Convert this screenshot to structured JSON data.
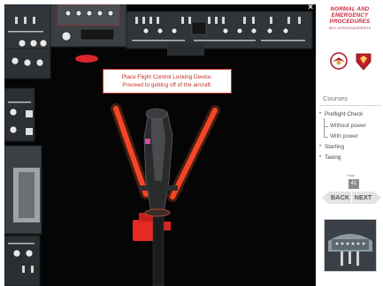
{
  "window": {
    "close_glyph": "×"
  },
  "simulation": {
    "instruction_line1": "Place Flight Control Locking Device.",
    "instruction_line2": "Proceed to getting off of the aircraft.",
    "accent_color": "#d9262a"
  },
  "sidebar": {
    "brand_lines": [
      "NORMAL AND",
      "EMERGENCY",
      "PROCEDURES"
    ],
    "brand_subtitle": "BELL 407B ENGAGEMENTS",
    "courses_title": "Courses",
    "courses": [
      {
        "label": "Preflight Check",
        "level": 0
      },
      {
        "label": "Without power",
        "level": 1
      },
      {
        "label": "With power",
        "level": 1
      },
      {
        "label": "Starting",
        "level": 0
      },
      {
        "label": "Taxing",
        "level": 0
      }
    ],
    "page_caption": "Page",
    "page_number": "41",
    "back_label": "BACK",
    "next_label": "NEXT",
    "brand_color": "#c8263a"
  }
}
